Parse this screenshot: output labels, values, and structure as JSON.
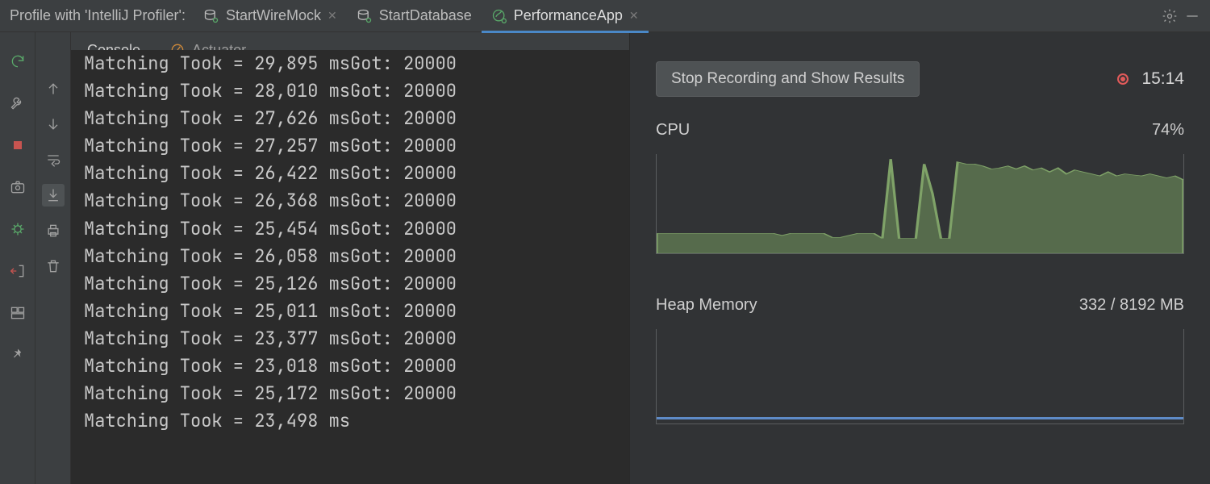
{
  "topbar": {
    "label": "Profile with 'IntelliJ Profiler':",
    "tabs": [
      {
        "label": "StartWireMock",
        "icon": "db-run",
        "closable": true,
        "active": false
      },
      {
        "label": "StartDatabase",
        "icon": "db-run",
        "closable": false,
        "active": false
      },
      {
        "label": "PerformanceApp",
        "icon": "spring-run",
        "closable": true,
        "active": true
      }
    ]
  },
  "sub_tabs": {
    "items": [
      {
        "label": "Console",
        "active": true
      },
      {
        "label": "Actuator",
        "active": false,
        "icon": "actuator"
      }
    ]
  },
  "console": {
    "lines": [
      "Matching Took = 29,895 msGot: 20000",
      "Matching Took = 28,010 msGot: 20000",
      "Matching Took = 27,626 msGot: 20000",
      "Matching Took = 27,257 msGot: 20000",
      "Matching Took = 26,422 msGot: 20000",
      "Matching Took = 26,368 msGot: 20000",
      "Matching Took = 25,454 msGot: 20000",
      "Matching Took = 26,058 msGot: 20000",
      "Matching Took = 25,126 msGot: 20000",
      "Matching Took = 25,011 msGot: 20000",
      "Matching Took = 23,377 msGot: 20000",
      "Matching Took = 23,018 msGot: 20000",
      "Matching Took = 25,172 msGot: 20000",
      "Matching Took = 23,498 ms"
    ]
  },
  "profiler": {
    "stop_label": "Stop Recording and Show Results",
    "time": "15:14",
    "cpu_label": "CPU",
    "cpu_value": "74%",
    "heap_label": "Heap Memory",
    "heap_value": "332 / 8192 MB"
  },
  "chart_data": [
    {
      "type": "area",
      "title": "CPU",
      "ylabel": "%",
      "ylim": [
        0,
        100
      ],
      "x": [
        0,
        1,
        2,
        3,
        4,
        5,
        6,
        7,
        8,
        9,
        10,
        11,
        12,
        13,
        14,
        15,
        16,
        17,
        18,
        19,
        20,
        21,
        22,
        23,
        24,
        25,
        26,
        27,
        28,
        29,
        30,
        31,
        32,
        33,
        34,
        35,
        36,
        37,
        38,
        39,
        40,
        41,
        42,
        43,
        44,
        45,
        46,
        47,
        48,
        49,
        50,
        51,
        52,
        53,
        54,
        55,
        56,
        57,
        58,
        59,
        60,
        61,
        62,
        63
      ],
      "values": [
        20,
        20,
        20,
        20,
        20,
        20,
        20,
        20,
        20,
        20,
        20,
        20,
        20,
        20,
        20,
        18,
        20,
        20,
        20,
        20,
        20,
        16,
        16,
        18,
        20,
        20,
        20,
        15,
        95,
        15,
        15,
        15,
        90,
        60,
        15,
        15,
        92,
        90,
        90,
        88,
        85,
        86,
        88,
        85,
        88,
        84,
        86,
        82,
        86,
        80,
        84,
        82,
        80,
        78,
        82,
        78,
        80,
        79,
        78,
        80,
        78,
        76,
        78,
        74
      ],
      "color": "#6e8e5e"
    },
    {
      "type": "line",
      "title": "Heap Memory",
      "ylabel": "MB",
      "ylim": [
        0,
        8192
      ],
      "x": [
        0,
        63
      ],
      "values": [
        332,
        332
      ],
      "color": "#5e8bc7"
    }
  ]
}
